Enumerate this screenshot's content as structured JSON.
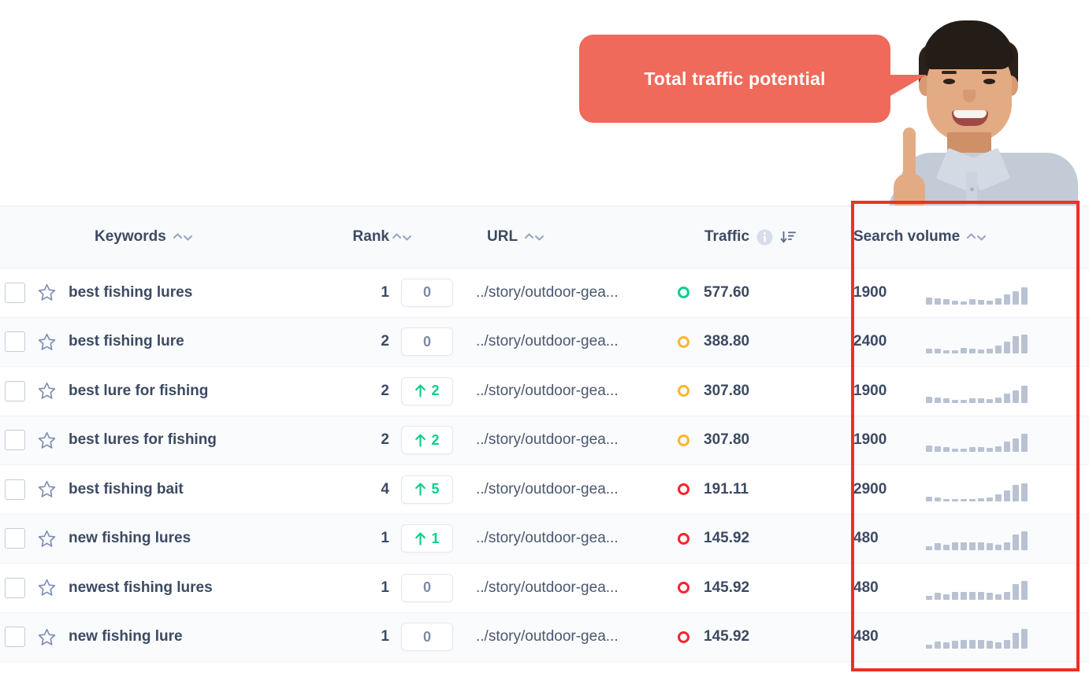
{
  "callout": {
    "text": "Total traffic potential",
    "color": "#ef6a5a"
  },
  "highlight": {
    "color": "#f0301f",
    "target_column": "Search volume"
  },
  "table": {
    "columns": [
      {
        "key": "keywords",
        "label": "Keywords",
        "sort_icon": "sort-updown-icon"
      },
      {
        "key": "rank",
        "label": "Rank",
        "sort_icon": "sort-updown-icon"
      },
      {
        "key": "url",
        "label": "URL",
        "sort_icon": "sort-updown-icon"
      },
      {
        "key": "traffic",
        "label": "Traffic",
        "info_icon": "info-icon",
        "sort_icon": "sort-descending-icon"
      },
      {
        "key": "search_volume",
        "label": "Search volume",
        "sort_icon": "sort-updown-icon"
      }
    ],
    "rows": [
      {
        "keyword": "best fishing lures",
        "rank": "1",
        "delta": "0",
        "delta_dir": "none",
        "url": "../story/outdoor-gea...",
        "traffic": "577.60",
        "traffic_status": "green",
        "volume": "1900",
        "spark": [
          9,
          8,
          7,
          5,
          4,
          7,
          6,
          5,
          8,
          13,
          17,
          22
        ]
      },
      {
        "keyword": "best fishing lure",
        "rank": "2",
        "delta": "0",
        "delta_dir": "none",
        "url": "../story/outdoor-gea...",
        "traffic": "388.80",
        "traffic_status": "yellow",
        "volume": "2400",
        "spark": [
          6,
          6,
          4,
          4,
          7,
          6,
          5,
          6,
          10,
          15,
          22,
          24
        ]
      },
      {
        "keyword": "best lure for fishing",
        "rank": "2",
        "delta": "2",
        "delta_dir": "up",
        "url": "../story/outdoor-gea...",
        "traffic": "307.80",
        "traffic_status": "yellow",
        "volume": "1900",
        "spark": [
          8,
          7,
          6,
          4,
          4,
          6,
          6,
          5,
          7,
          12,
          16,
          22
        ]
      },
      {
        "keyword": "best lures for fishing",
        "rank": "2",
        "delta": "2",
        "delta_dir": "up",
        "url": "../story/outdoor-gea...",
        "traffic": "307.80",
        "traffic_status": "yellow",
        "volume": "1900",
        "spark": [
          8,
          7,
          6,
          4,
          4,
          6,
          6,
          5,
          7,
          13,
          17,
          23
        ]
      },
      {
        "keyword": "best fishing bait",
        "rank": "4",
        "delta": "5",
        "delta_dir": "up",
        "url": "../story/outdoor-gea...",
        "traffic": "191.11",
        "traffic_status": "red",
        "volume": "2900",
        "spark": [
          6,
          5,
          3,
          3,
          3,
          3,
          4,
          5,
          9,
          14,
          21,
          23
        ]
      },
      {
        "keyword": "new fishing lures",
        "rank": "1",
        "delta": "1",
        "delta_dir": "up",
        "url": "../story/outdoor-gea...",
        "traffic": "145.92",
        "traffic_status": "red",
        "volume": "480",
        "spark": [
          5,
          9,
          7,
          10,
          10,
          10,
          10,
          9,
          7,
          10,
          20,
          24
        ]
      },
      {
        "keyword": "newest fishing lures",
        "rank": "1",
        "delta": "0",
        "delta_dir": "none",
        "url": "../story/outdoor-gea...",
        "traffic": "145.92",
        "traffic_status": "red",
        "volume": "480",
        "spark": [
          5,
          9,
          7,
          10,
          10,
          10,
          10,
          9,
          7,
          10,
          20,
          24
        ]
      },
      {
        "keyword": "new fishing lure",
        "rank": "1",
        "delta": "0",
        "delta_dir": "none",
        "url": "../story/outdoor-gea...",
        "traffic": "145.92",
        "traffic_status": "red",
        "volume": "480",
        "spark": [
          5,
          9,
          8,
          10,
          11,
          11,
          11,
          10,
          8,
          11,
          20,
          25
        ]
      }
    ]
  },
  "icons": {
    "checkbox": "checkbox-icon",
    "star": "star-icon",
    "up_arrow": "arrow-up-icon"
  }
}
